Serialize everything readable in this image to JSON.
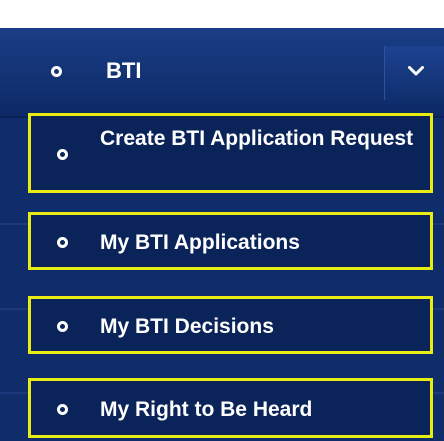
{
  "menu": {
    "header": {
      "label": "BTI",
      "bullet_icon": "circle-bullet-icon",
      "toggle_icon": "chevron-down-icon",
      "expanded": true
    },
    "items": [
      {
        "label": "Create BTI Application Request",
        "icon": "circle-bullet-icon",
        "highlighted": true
      },
      {
        "label": "My BTI Applications",
        "icon": "circle-bullet-icon",
        "highlighted": true
      },
      {
        "label": "My BTI Decisions",
        "icon": "circle-bullet-icon",
        "highlighted": true
      },
      {
        "label": "My Right to Be Heard",
        "icon": "circle-bullet-icon",
        "highlighted": true
      }
    ]
  },
  "colors": {
    "menu_background": "#0f2d6a",
    "highlight_border": "#e8ec12",
    "text": "#ffffff"
  }
}
